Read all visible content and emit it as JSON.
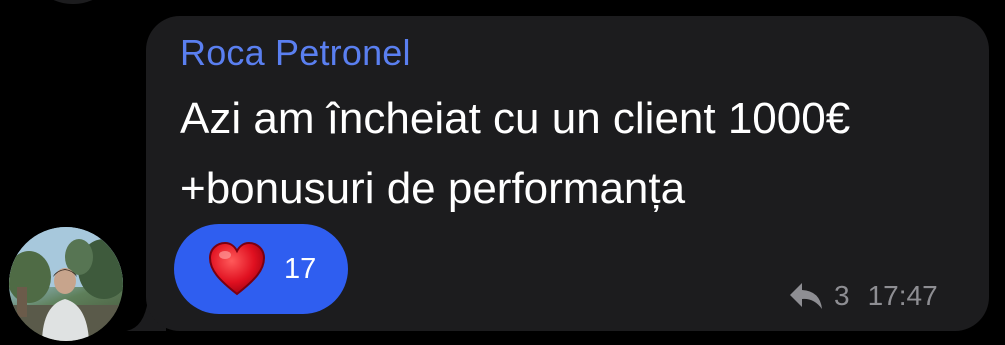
{
  "message": {
    "sender": "Roca Petronel",
    "text_lines": [
      "Azi am încheiat cu un client 1000€",
      "+bonusuri de performanța"
    ],
    "reaction": {
      "emoji": "heart-icon",
      "count": "17"
    },
    "replies": "3",
    "time": "17:47"
  },
  "colors": {
    "background": "#000000",
    "bubble": "#1c1c1e",
    "sender": "#5a7ff0",
    "reaction_pill": "#2f5ef0",
    "meta": "#8e8e93"
  }
}
